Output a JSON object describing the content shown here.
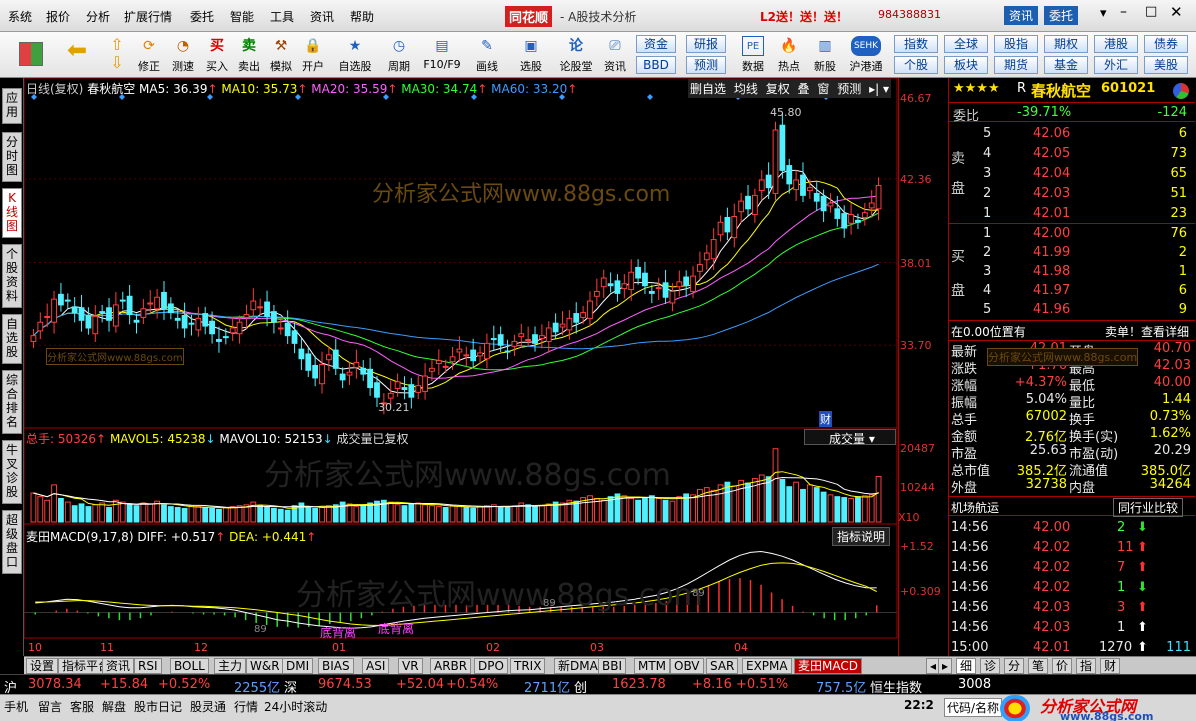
{
  "menu": {
    "items": [
      "系统",
      "报价",
      "分析",
      "扩展行情",
      "委托",
      "智能",
      "工具",
      "资讯",
      "帮助"
    ],
    "brand": "同花顺",
    "subtitle": "- A股技术分析",
    "promo": "L2送！送！送！",
    "account": "984388831",
    "btn_info": "资讯",
    "btn_trade": "委托"
  },
  "toolbar": {
    "items": [
      "修正",
      "测速",
      "买入",
      "卖出",
      "模拟",
      "开户",
      "自选股",
      "周期",
      "F10/F9",
      "画线",
      "选股",
      "论股堂",
      "资讯",
      "数据",
      "热点",
      "新股",
      "沪港通"
    ],
    "right_row1": [
      "资金",
      "研报",
      "指数",
      "全球",
      "股指",
      "期权",
      "港股",
      "债券"
    ],
    "right_row2": [
      "BBD",
      "预测",
      "个股",
      "板块",
      "期货",
      "基金",
      "外汇",
      "美股"
    ]
  },
  "left_tabs": [
    "应用",
    "分时图",
    "K线图",
    "个股资料",
    "自选股",
    "综合排名",
    "牛叉诊股",
    "超级盘口"
  ],
  "chart_header": {
    "period": "日线(复权)",
    "name": "春秋航空",
    "ma5": "MA5: 36.39",
    "ma10": "MA10: 35.73",
    "ma20": "MA20: 35.59",
    "ma30": "MA30: 34.74",
    "ma60": "MA60: 33.20",
    "btns": [
      "删自选",
      "均线",
      "复权",
      "叠",
      "窗",
      "预测"
    ]
  },
  "price_axis": [
    "46.67",
    "42.36",
    "38.01",
    "33.70"
  ],
  "annotations": {
    "high": "45.80",
    "low": "30.21",
    "cai": "财",
    "watermark": "分析家公式网www.88gs.com"
  },
  "volume_header": {
    "total": "总手: 50326",
    "mavol5": "MAVOL5: 45238",
    "mavol10": "MAVOL10: 52153",
    "note": "成交量已复权",
    "select": "成交量"
  },
  "volume_axis": [
    "20487",
    "10244",
    "X10"
  ],
  "macd_header": {
    "name": "麦田MACD(9,17,8)",
    "diff": "DIFF: +0.517",
    "dea": "DEA: +0.441",
    "btn": "指标说明"
  },
  "macd_axis": [
    "+1.52",
    "+0.309"
  ],
  "macd_labels": {
    "div1": "底背离",
    "div2": "底背离",
    "n1": "89",
    "n2": "89",
    "n3": "89"
  },
  "months": [
    "10",
    "11",
    "12",
    "01",
    "02",
    "03",
    "04"
  ],
  "chart_data": {
    "type": "candlestick",
    "title": "春秋航空",
    "note": "daily candles, values estimated from price axis",
    "ylim": [
      29.5,
      46.67
    ],
    "x": [
      "10",
      "11",
      "12",
      "01",
      "02",
      "03",
      "04"
    ],
    "close_series": [
      34.2,
      34.9,
      35.2,
      36.1,
      35.8,
      36.0,
      35.4,
      35.0,
      34.6,
      35.2,
      35.4,
      35.0,
      35.8,
      36.0,
      35.3,
      34.9,
      35.6,
      35.9,
      36.2,
      35.6,
      35.4,
      35.0,
      34.6,
      34.8,
      35.1,
      34.7,
      34.3,
      33.9,
      34.1,
      34.6,
      34.9,
      35.3,
      36.0,
      35.7,
      35.2,
      34.9,
      34.6,
      34.2,
      33.8,
      33.0,
      32.4,
      32.0,
      32.7,
      33.2,
      32.5,
      31.9,
      32.3,
      32.8,
      32.2,
      31.5,
      31.0,
      30.7,
      31.2,
      31.8,
      31.4,
      31.0,
      31.6,
      32.1,
      32.5,
      32.9,
      32.6,
      33.1,
      33.5,
      33.2,
      32.9,
      33.3,
      33.8,
      34.0,
      33.7,
      33.4,
      33.9,
      34.3,
      34.0,
      33.8,
      34.2,
      34.6,
      34.4,
      34.8,
      35.1,
      34.9,
      35.4,
      36.0,
      36.5,
      37.2,
      36.8,
      36.4,
      36.9,
      37.5,
      37.2,
      36.8,
      36.4,
      36.7,
      36.2,
      36.5,
      37.0,
      36.8,
      37.3,
      37.9,
      38.5,
      39.2,
      40.1,
      39.6,
      40.4,
      41.2,
      40.8,
      41.5,
      42.3,
      41.9,
      44.9,
      42.8,
      42.1,
      42.3,
      41.5,
      41.9,
      41.2,
      40.7,
      41.1,
      40.3,
      39.8,
      40.5,
      40.1,
      40.6,
      41.1,
      42.01
    ],
    "volume": [
      32000,
      28000,
      24000,
      41000,
      26000,
      22000,
      18000,
      20000,
      17000,
      19000,
      21000,
      16000,
      24000,
      22000,
      19000,
      18000,
      21000,
      20000,
      23000,
      19000,
      17000,
      16000,
      15000,
      18000,
      17000,
      16000,
      15000,
      14000,
      16000,
      17000,
      18000,
      19000,
      22000,
      18000,
      16000,
      15000,
      14000,
      13000,
      18000,
      21000,
      17000,
      15000,
      16000,
      18000,
      19000,
      22000,
      20000,
      17000,
      18000,
      21000,
      23000,
      24000,
      22000,
      19000,
      18000,
      20000,
      21000,
      19000,
      18000,
      17000,
      16000,
      18000,
      17000,
      16000,
      15000,
      17000,
      18000,
      19000,
      17000,
      16000,
      18000,
      21000,
      19000,
      17000,
      18000,
      20000,
      22000,
      21000,
      24000,
      23000,
      27000,
      29000,
      26000,
      24000,
      28000,
      31000,
      29000,
      26000,
      24000,
      27000,
      29000,
      26000,
      24000,
      23000,
      28000,
      31000,
      30000,
      36000,
      38000,
      35000,
      41000,
      44000,
      40000,
      46000,
      43000,
      48000,
      52000,
      50000,
      81000,
      47000,
      39000,
      44000,
      36000,
      41000,
      38000,
      33000,
      30000,
      28000,
      27000,
      26000,
      28000,
      29000,
      30000,
      50326
    ],
    "macd_diff": [
      0.2,
      0.22,
      0.25,
      0.28,
      0.27,
      0.24,
      0.2,
      0.16,
      0.12,
      0.1,
      0.1,
      0.12,
      0.14,
      0.15,
      0.14,
      0.12,
      0.11,
      0.1,
      0.08,
      0.05,
      0.0,
      -0.05,
      -0.1,
      -0.15,
      -0.18,
      -0.22,
      -0.25,
      -0.28,
      -0.3,
      -0.32,
      -0.33,
      -0.32,
      -0.3,
      -0.26,
      -0.22,
      -0.18,
      -0.15,
      -0.12,
      -0.1,
      -0.08,
      -0.06,
      -0.04,
      -0.02,
      0.0,
      0.02,
      0.04,
      0.05,
      0.06,
      0.08,
      0.1,
      0.12,
      0.14,
      0.16,
      0.18,
      0.2,
      0.22,
      0.25,
      0.28,
      0.32,
      0.36,
      0.42,
      0.5,
      0.6,
      0.72,
      0.85,
      0.98,
      1.1,
      1.2,
      1.26,
      1.28,
      1.24,
      1.18,
      1.1,
      1.0,
      0.9,
      0.8,
      0.7,
      0.62,
      0.56,
      0.52,
      0.517
    ],
    "macd_dea": [
      0.22,
      0.22,
      0.23,
      0.24,
      0.25,
      0.25,
      0.24,
      0.22,
      0.2,
      0.18,
      0.16,
      0.15,
      0.14,
      0.14,
      0.14,
      0.13,
      0.13,
      0.12,
      0.11,
      0.1,
      0.08,
      0.06,
      0.03,
      0.0,
      -0.03,
      -0.06,
      -0.1,
      -0.14,
      -0.18,
      -0.21,
      -0.24,
      -0.26,
      -0.27,
      -0.27,
      -0.26,
      -0.24,
      -0.22,
      -0.2,
      -0.18,
      -0.16,
      -0.14,
      -0.12,
      -0.1,
      -0.08,
      -0.06,
      -0.04,
      -0.02,
      0.0,
      0.02,
      0.04,
      0.06,
      0.08,
      0.1,
      0.12,
      0.14,
      0.16,
      0.18,
      0.2,
      0.23,
      0.26,
      0.3,
      0.35,
      0.41,
      0.48,
      0.56,
      0.65,
      0.75,
      0.84,
      0.92,
      0.99,
      1.03,
      1.04,
      1.03,
      0.99,
      0.93,
      0.86,
      0.78,
      0.7,
      0.62,
      0.55,
      0.441
    ]
  },
  "quote": {
    "stars": "★★★★",
    "prefix": "R",
    "name": "春秋航空",
    "code": "601021",
    "weibi_label": "委比",
    "weibi": "-39.71%",
    "weicha": "-124",
    "sell_label1": "卖",
    "sell_label2": "盘",
    "buy_label1": "买",
    "buy_label2": "盘",
    "sell": [
      {
        "n": "5",
        "p": "42.06",
        "v": "6"
      },
      {
        "n": "4",
        "p": "42.05",
        "v": "73"
      },
      {
        "n": "3",
        "p": "42.04",
        "v": "65"
      },
      {
        "n": "2",
        "p": "42.03",
        "v": "51"
      },
      {
        "n": "1",
        "p": "42.01",
        "v": "23"
      }
    ],
    "buy": [
      {
        "n": "1",
        "p": "42.00",
        "v": "76"
      },
      {
        "n": "2",
        "p": "41.99",
        "v": "2"
      },
      {
        "n": "3",
        "p": "41.98",
        "v": "1"
      },
      {
        "n": "4",
        "p": "41.97",
        "v": "6"
      },
      {
        "n": "5",
        "p": "41.96",
        "v": "9"
      }
    ],
    "pos_note": "在0.00位置有",
    "sell_one": "卖单！查看详细",
    "stats": [
      [
        "最新",
        "42.01",
        "开盘",
        "40.70"
      ],
      [
        "涨跌",
        "+1.76",
        "最高",
        "42.03"
      ],
      [
        "涨幅",
        "+4.37%",
        "最低",
        "40.00"
      ],
      [
        "振幅",
        "5.04%",
        "量比",
        "1.44"
      ],
      [
        "总手",
        "67002",
        "换手",
        "0.73%"
      ],
      [
        "金额",
        "2.76亿",
        "换手(实)",
        "1.62%"
      ],
      [
        "市盈",
        "25.63",
        "市盈(动)",
        "20.29"
      ],
      [
        "总市值",
        "385.2亿",
        "流通值",
        "385.0亿"
      ],
      [
        "外盘",
        "32738",
        "内盘",
        "34264"
      ]
    ],
    "sector": "机场航运",
    "sector_btn": "同行业比较",
    "ticks": [
      [
        "14:56",
        "42.00",
        "2",
        "down"
      ],
      [
        "14:56",
        "42.02",
        "11",
        "up"
      ],
      [
        "14:56",
        "42.02",
        "7",
        "up"
      ],
      [
        "14:56",
        "42.02",
        "1",
        "down"
      ],
      [
        "14:56",
        "42.03",
        "3",
        "up"
      ],
      [
        "14:56",
        "42.03",
        "1",
        "neutral"
      ],
      [
        "15:00",
        "42.01",
        "1270",
        "neutral"
      ]
    ],
    "tick_last_right": "111",
    "bottom_tabs": [
      "细",
      "诊",
      "分",
      "笔",
      "价",
      "指",
      "财"
    ]
  },
  "indicator_tabs": [
    "设置",
    "指标平台",
    "资讯",
    "RSI",
    "BOLL",
    "主力",
    "W&R",
    "DMI",
    "BIAS",
    "ASI",
    "VR",
    "ARBR",
    "DPO",
    "TRIX",
    "新DMA",
    "BBI",
    "MTM",
    "OBV",
    "SAR",
    "EXPMA",
    "麦田MACD"
  ],
  "ticker": {
    "sh_label": "沪",
    "sh": "3078.34",
    "sh_chg": "+15.84",
    "sh_pct": "+0.52%",
    "sh_amt": "2255亿",
    "sz_label": "深",
    "sz": "9674.53",
    "sz_chg": "+52.04",
    "sz_pct": "+0.54%",
    "sz_amt": "2711亿",
    "cy_label": "创",
    "cy": "1623.78",
    "cy_chg": "+8.16",
    "cy_pct": "+0.51%",
    "cy_amt": "757.5亿",
    "hs": "恒生指数",
    "hs_val": "3008"
  },
  "statusbar": {
    "items": [
      "手机",
      "留言",
      "客服",
      "解盘",
      "股市日记",
      "股灵通",
      "行情",
      "24小时滚动"
    ],
    "time": "22:2",
    "code_label": "代码/名称",
    "logo": "分析家公式网",
    "logo_url": "www.88gs.com"
  },
  "colors": {
    "up": "#ff3c3c",
    "down": "#50f0ff",
    "ma5": "#ffffff",
    "ma10": "#ffff00",
    "ma20": "#ff60ff",
    "ma30": "#30ff30",
    "ma60": "#3c9cff"
  }
}
